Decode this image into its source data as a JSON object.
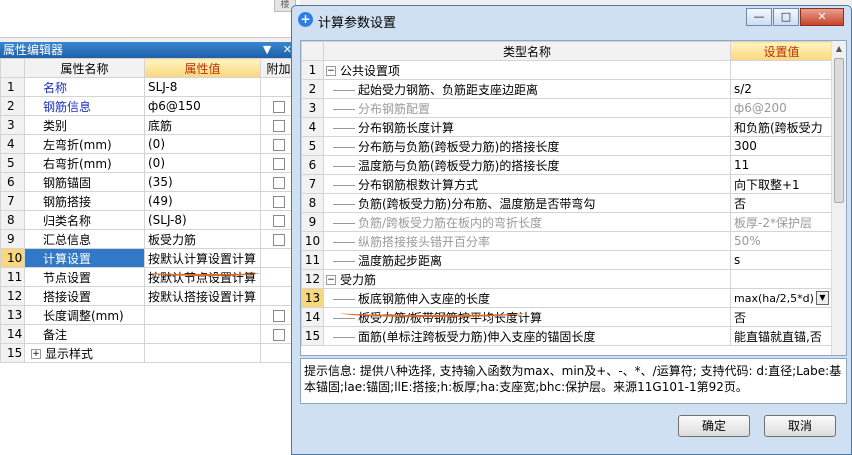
{
  "top_tab_stub": "楼",
  "property_editor": {
    "title": "属性编辑器",
    "pin_icon": "pin-icon",
    "close_icon": "close-icon",
    "columns": [
      "属性名称",
      "属性值",
      "附加"
    ],
    "rows": [
      {
        "num": "1",
        "name": "名称",
        "value": "SLJ-8",
        "blue": true,
        "checkbox": false
      },
      {
        "num": "2",
        "name": "钢筋信息",
        "value": "ф6@150",
        "blue": true,
        "checkbox": true
      },
      {
        "num": "3",
        "name": "类别",
        "value": "底筋",
        "blue": false,
        "checkbox": true
      },
      {
        "num": "4",
        "name": "左弯折(mm)",
        "value": "(0)",
        "blue": false,
        "checkbox": true
      },
      {
        "num": "5",
        "name": "右弯折(mm)",
        "value": "(0)",
        "blue": false,
        "checkbox": true
      },
      {
        "num": "6",
        "name": "钢筋锚固",
        "value": "(35)",
        "blue": false,
        "checkbox": true
      },
      {
        "num": "7",
        "name": "钢筋搭接",
        "value": "(49)",
        "blue": false,
        "checkbox": true
      },
      {
        "num": "8",
        "name": "归类名称",
        "value": "(SLJ-8)",
        "blue": false,
        "checkbox": true
      },
      {
        "num": "9",
        "name": "汇总信息",
        "value": "板受力筋",
        "blue": false,
        "checkbox": true
      },
      {
        "num": "10",
        "name": "计算设置",
        "value": "按默认计算设置计算",
        "blue": false,
        "checkbox": false,
        "selected": true
      },
      {
        "num": "11",
        "name": "节点设置",
        "value": "按默认节点设置计算",
        "blue": false,
        "checkbox": false
      },
      {
        "num": "12",
        "name": "搭接设置",
        "value": "按默认搭接设置计算",
        "blue": false,
        "checkbox": false
      },
      {
        "num": "13",
        "name": "长度调整(mm)",
        "value": "",
        "blue": false,
        "checkbox": true
      },
      {
        "num": "14",
        "name": "备注",
        "value": "",
        "blue": false,
        "checkbox": true
      },
      {
        "num": "15",
        "name": "显示样式",
        "value": "",
        "blue": false,
        "checkbox": false,
        "expandable": true
      }
    ]
  },
  "dialog": {
    "title": "计算参数设置",
    "app_icon": "plus-circle-icon",
    "window_buttons": {
      "minimize": "—",
      "maximize": "□",
      "close": "✕"
    },
    "columns": [
      "类型名称",
      "设置值"
    ],
    "rows": [
      {
        "num": "1",
        "name": "公共设置项",
        "value": "",
        "group": true,
        "gray": false
      },
      {
        "num": "2",
        "name": "起始受力钢筋、负筋距支座边距离",
        "value": "s/2",
        "gray": false
      },
      {
        "num": "3",
        "name": "分布钢筋配置",
        "value": "ф6@200",
        "gray": true
      },
      {
        "num": "4",
        "name": "分布钢筋长度计算",
        "value": "和负筋(跨板受力",
        "gray": false
      },
      {
        "num": "5",
        "name": "分布筋与负筋(跨板受力筋)的搭接长度",
        "value": "300",
        "gray": false
      },
      {
        "num": "6",
        "name": "温度筋与负筋(跨板受力筋)的搭接长度",
        "value": "11",
        "gray": false
      },
      {
        "num": "7",
        "name": "分布钢筋根数计算方式",
        "value": "向下取整+1",
        "gray": false
      },
      {
        "num": "8",
        "name": "负筋(跨板受力筋)分布筋、温度筋是否带弯勾",
        "value": "否",
        "gray": false
      },
      {
        "num": "9",
        "name": "负筋/跨板受力筋在板内的弯折长度",
        "value": "板厚-2*保护层",
        "gray": true
      },
      {
        "num": "10",
        "name": "纵筋搭接接头错开百分率",
        "value": "50%",
        "gray": true
      },
      {
        "num": "11",
        "name": "温度筋起步距离",
        "value": "s",
        "gray": false
      },
      {
        "num": "12",
        "name": "受力筋",
        "value": "",
        "group": true,
        "gray": false
      },
      {
        "num": "13",
        "name": "板底钢筋伸入支座的长度",
        "value": "max(ha/2,5*d)",
        "gray": false,
        "selected": true,
        "combo": true
      },
      {
        "num": "14",
        "name": "板受力筋/板带钢筋按平均长度计算",
        "value": "否",
        "gray": false
      },
      {
        "num": "15",
        "name": "面筋(单标注跨板受力筋)伸入支座的锚固长度",
        "value": "能直锚就直锚,否",
        "gray": false
      }
    ],
    "hint_text": "提示信息: 提供八种选择, 支持输入函数为max、min及+、-、*、/运算符; 支持代码: d:直径;Labe:基本锚固;lae:锚固;llE:搭接;h:板厚;ha:支座宽;bhc:保护层。来源11G101-1第92页。",
    "ok_label": "确定",
    "cancel_label": "取消"
  }
}
